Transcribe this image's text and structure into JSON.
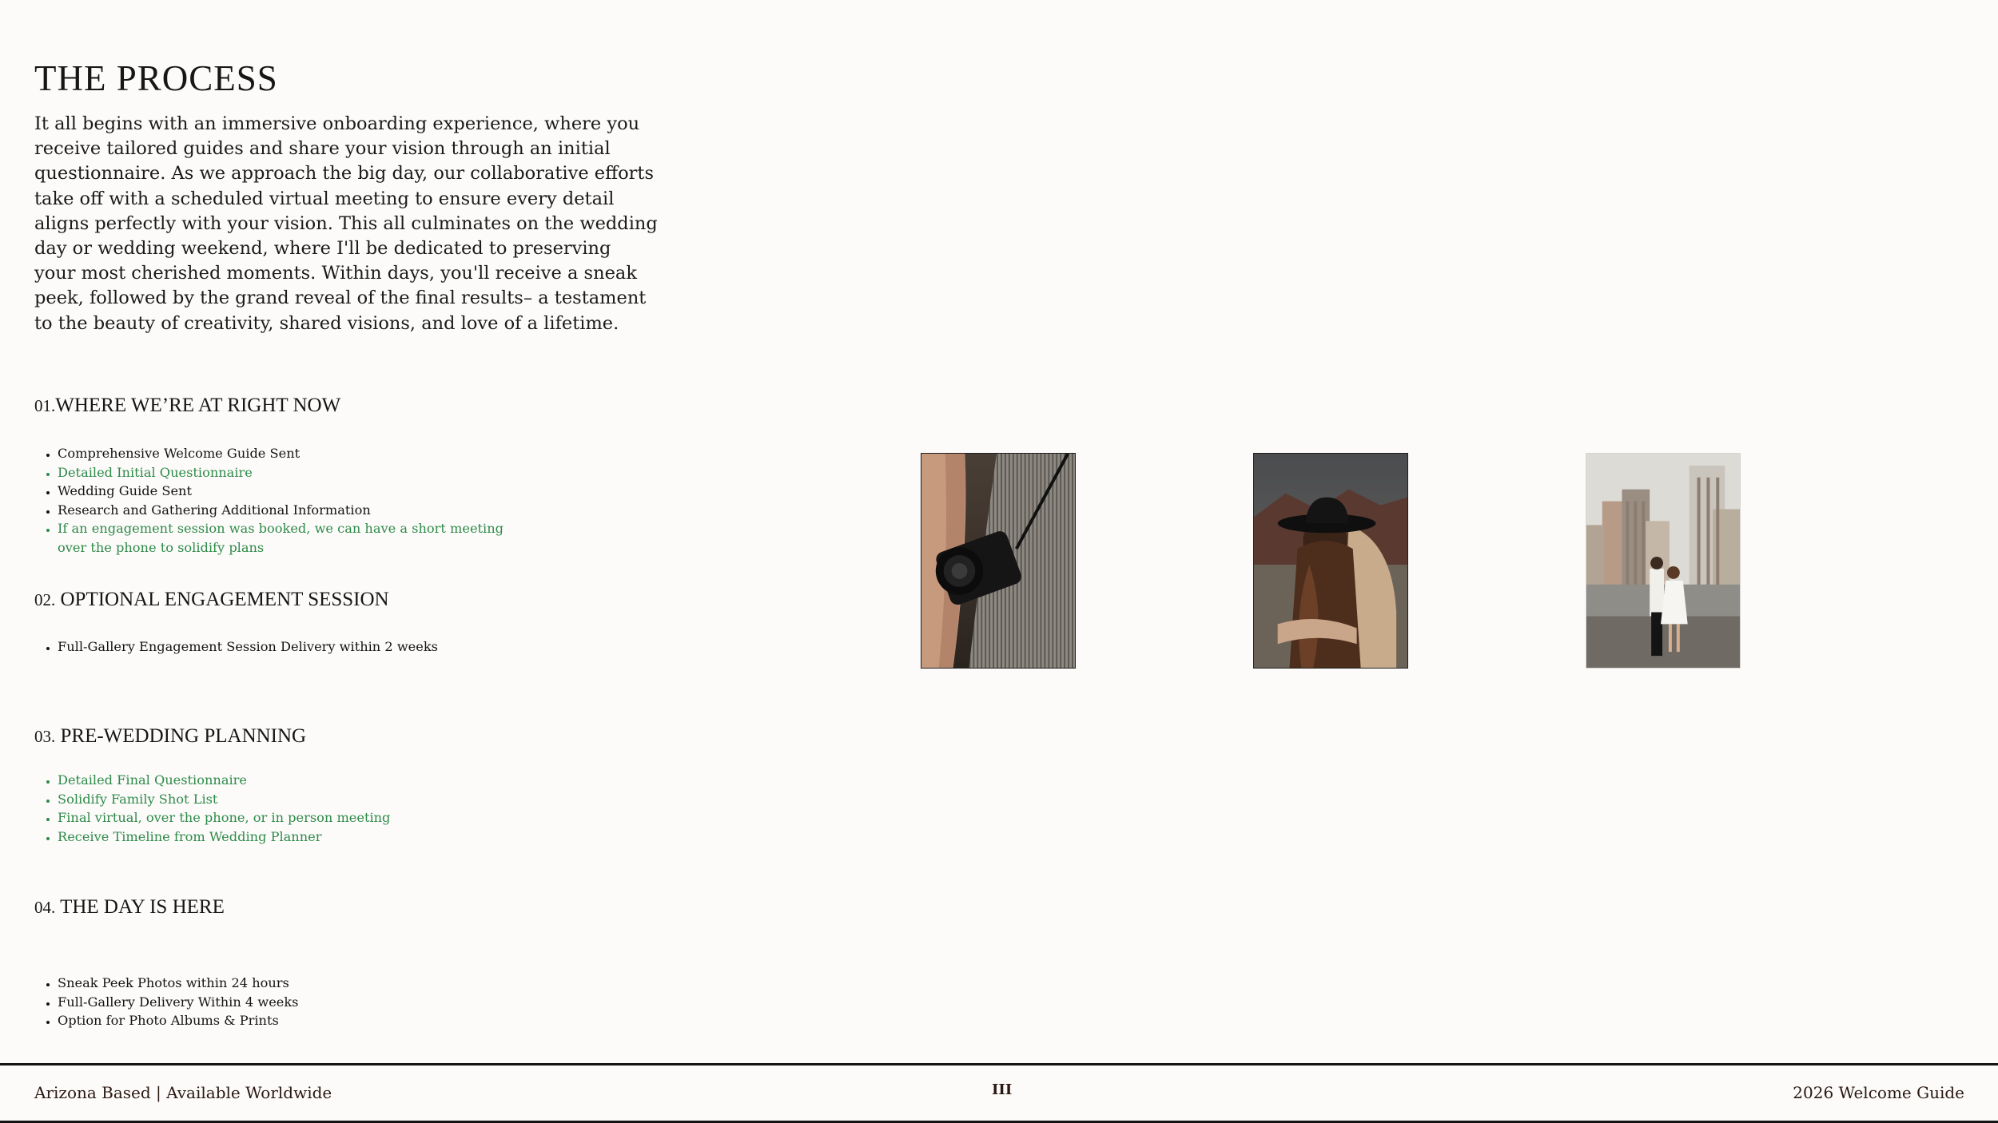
{
  "page": {
    "title": "THE PROCESS",
    "intro": "It all begins with an immersive onboarding experience, where you receive tailored guides and share your vision through an initial questionnaire. As we approach the big day, our collaborative efforts take off with a scheduled virtual meeting to ensure every detail aligns perfectly with your vision. This all culminates on the wedding day or wedding weekend, where I'll be dedicated to preserving your most cherished moments. Within days, you'll receive a sneak peek, followed by the grand reveal of the final results– a testament to the beauty of creativity, shared visions, and love of a lifetime."
  },
  "sections": [
    {
      "number": "01.",
      "title": "WHERE WE’RE AT RIGHT NOW",
      "items": [
        {
          "text": "Comprehensive Welcome Guide Sent",
          "highlight": false
        },
        {
          "text": "Detailed Initial Questionnaire",
          "highlight": true
        },
        {
          "text": "Wedding Guide Sent",
          "highlight": false
        },
        {
          "text": "Research and Gathering Additional Information",
          "highlight": false
        },
        {
          "text": "If an engagement session was booked, we can have a short meeting over the phone to solidify plans",
          "highlight": true
        }
      ]
    },
    {
      "number": "02.",
      "title": "OPTIONAL ENGAGEMENT SESSION",
      "items": [
        {
          "text": "Full-Gallery Engagement Session Delivery within 2 weeks",
          "highlight": false
        }
      ]
    },
    {
      "number": "03.",
      "title": "PRE-WEDDING PLANNING",
      "items": [
        {
          "text": "Detailed Final Questionnaire",
          "highlight": true
        },
        {
          "text": "Solidify Family Shot List",
          "highlight": true
        },
        {
          "text": "Final virtual, over the phone, or in person meeting",
          "highlight": true
        },
        {
          "text": "Receive Timeline from Wedding Planner",
          "highlight": true
        }
      ]
    },
    {
      "number": "04.",
      "title": "THE DAY IS HERE",
      "items": [
        {
          "text": "Sneak Peek Photos within 24 hours",
          "highlight": false
        },
        {
          "text": "Full-Gallery Delivery Within 4 weeks",
          "highlight": false
        },
        {
          "text": "Option for Photo Albums & Prints",
          "highlight": false
        }
      ]
    }
  ],
  "photos": [
    {
      "subject": "camera-strap-photo"
    },
    {
      "subject": "cowboy-hat-couple-photo"
    },
    {
      "subject": "rooftop-city-couple-photo"
    }
  ],
  "footer": {
    "left": "Arizona Based | Available Worldwide",
    "page_number": "III",
    "right": "2026 Welcome Guide"
  },
  "colors": {
    "background": "#fcfbf9",
    "text": "#1b1b1b",
    "highlight_green": "#2e8a4a",
    "footer_text": "#2a1812"
  }
}
